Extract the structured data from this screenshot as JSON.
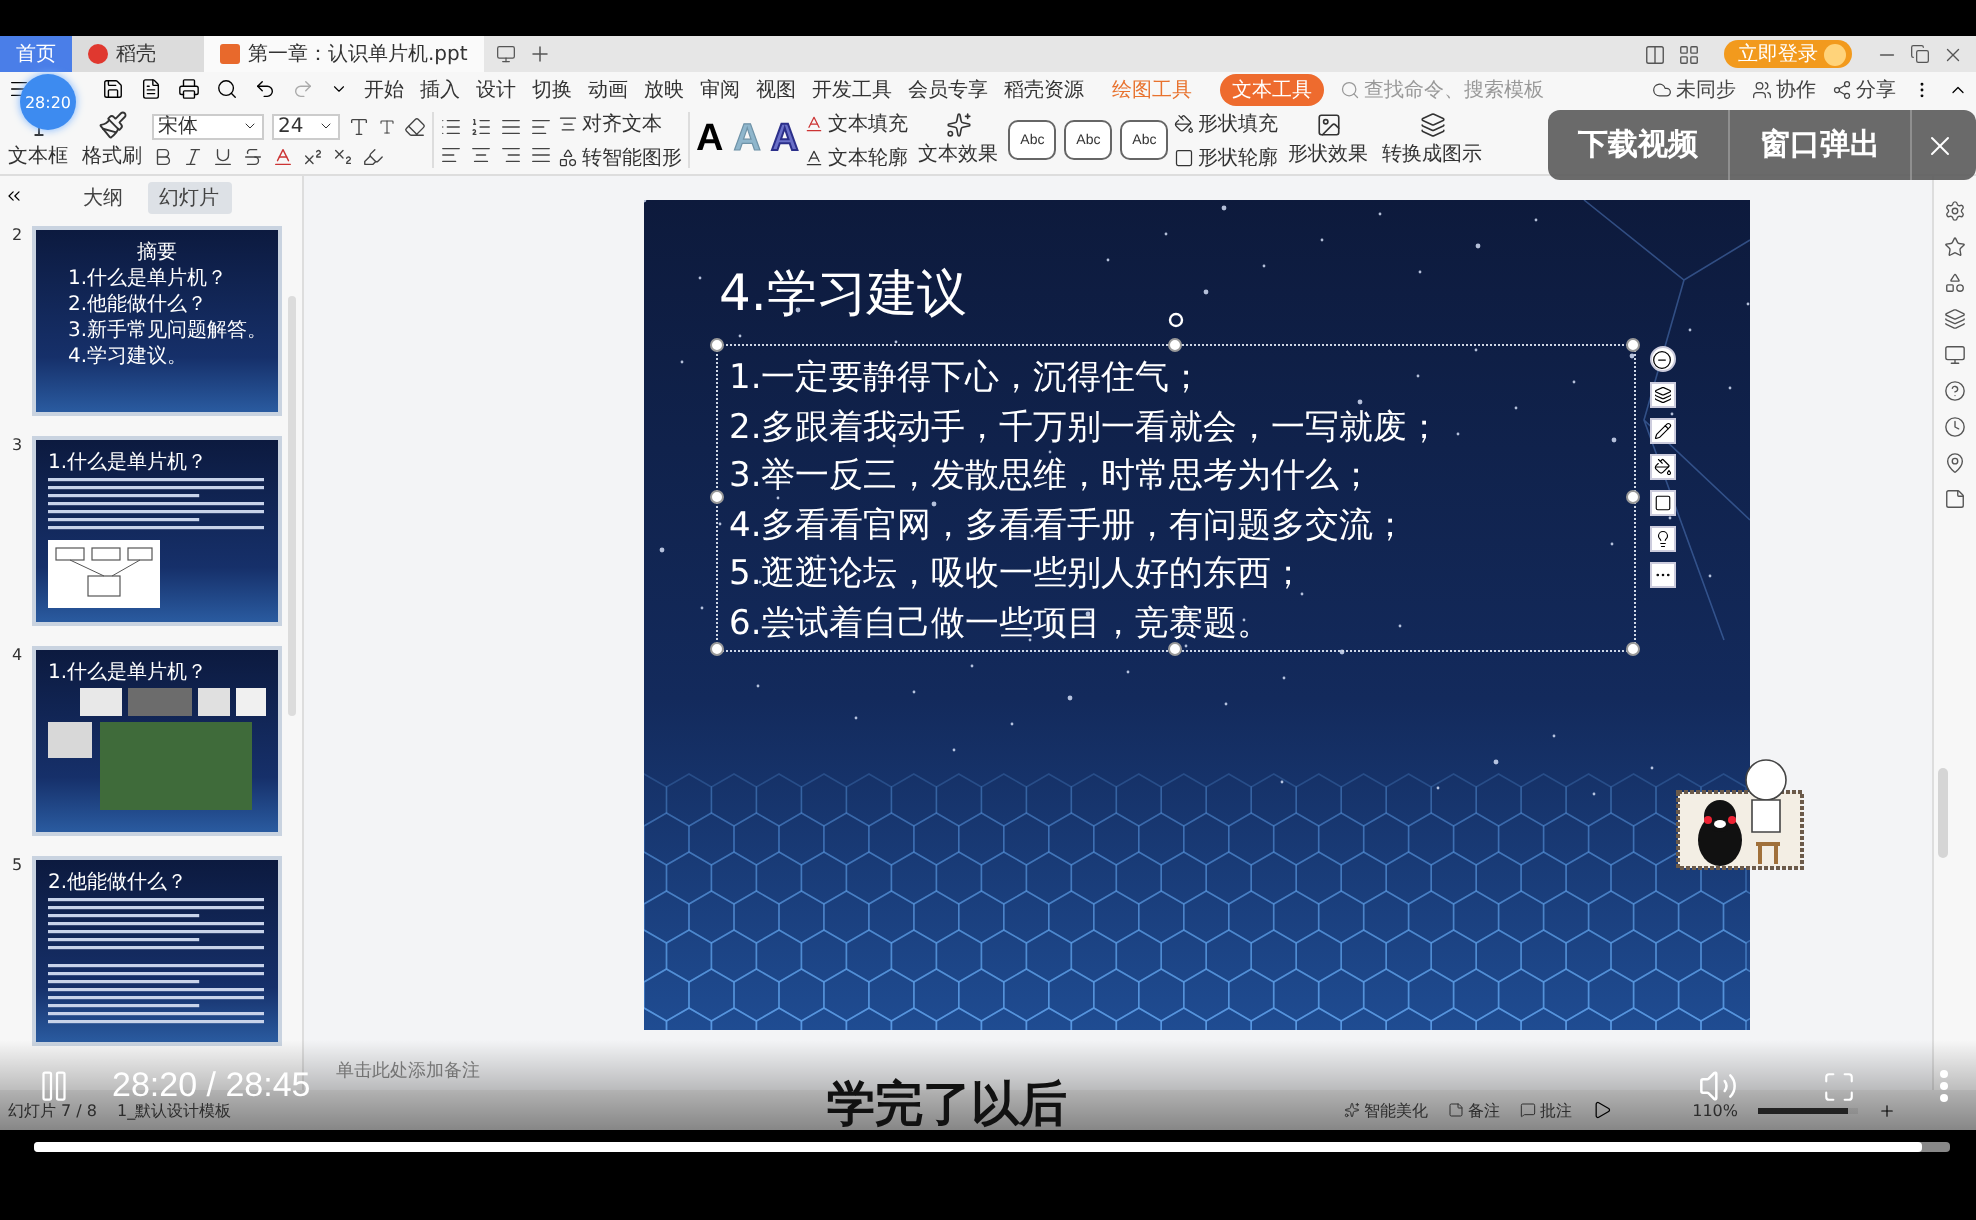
{
  "tab_bar": {
    "tabs": [
      {
        "label": "首页",
        "selected": false,
        "kind": "home"
      },
      {
        "label": "稻壳",
        "selected": false,
        "kind": "app"
      },
      {
        "label": "第一章：认识单片机.ppt",
        "selected": true,
        "kind": "doc"
      }
    ],
    "login": "立即登录"
  },
  "time_bubble": "28:20",
  "menu": {
    "items": [
      {
        "label": "开始",
        "selected": false
      },
      {
        "label": "插入",
        "selected": false
      },
      {
        "label": "设计",
        "selected": false
      },
      {
        "label": "切换",
        "selected": false
      },
      {
        "label": "动画",
        "selected": false
      },
      {
        "label": "放映",
        "selected": false
      },
      {
        "label": "审阅",
        "selected": false
      },
      {
        "label": "视图",
        "selected": false
      },
      {
        "label": "开发工具",
        "selected": false
      },
      {
        "label": "会员专享",
        "selected": false
      },
      {
        "label": "稻壳资源",
        "selected": false
      }
    ],
    "context_tabs": [
      {
        "label": "绘图工具",
        "selected": false
      },
      {
        "label": "文本工具",
        "selected": true
      }
    ],
    "search": {
      "placeholder": "查找命令、搜索模板"
    },
    "actions": [
      "未同步",
      "协作",
      "分享"
    ]
  },
  "ribbon": {
    "text_box": "文本框",
    "format_painter": "格式刷",
    "font": "宋体",
    "font_size": "24",
    "align_text": "对齐文本",
    "smart_art": "转智能图形",
    "text_fill": "文本填充",
    "text_outline": "文本轮廓",
    "text_effect": "文本效果",
    "text_styles": [
      "A",
      "A",
      "A"
    ],
    "style_samples": [
      "Abc",
      "Abc",
      "Abc"
    ],
    "shape_fill": "形状填充",
    "shape_outline": "形状轮廓",
    "shape_effect": "形状效果",
    "convert": "转换成图示"
  },
  "video_popup": {
    "buttons": [
      "下载视频",
      "窗口弹出"
    ]
  },
  "sidebar": {
    "tabs": [
      {
        "label": "大纲",
        "selected": false
      },
      {
        "label": "幻灯片",
        "selected": true
      }
    ],
    "slides": [
      {
        "number": "2",
        "kind": "list",
        "title": "摘要",
        "lines": [
          "1.什么是单片机？",
          "2.他能做什么？",
          "3.新手常见问题解答。",
          "4.学习建议。"
        ]
      },
      {
        "number": "3",
        "kind": "diagram",
        "title": "1.什么是单片机？"
      },
      {
        "number": "4",
        "kind": "photos",
        "title": "1.什么是单片机？"
      },
      {
        "number": "5",
        "kind": "text",
        "title": "2.他能做什么？"
      }
    ]
  },
  "slide": {
    "title": "4.学习建议",
    "lines": [
      "1.一定要静得下心，沉得住气；",
      "2.多跟着我动手，千万别一看就会，一写就废；",
      "3.举一反三，发散思维，时常思考为什么；",
      "4.多看看官网，多看看手册，有问题多交流；",
      "5.逛逛论坛，吸收一些别人好的东西；",
      "6.尝试着自己做一些项目，竞赛题。"
    ]
  },
  "notes": {
    "placeholder": "单击此处添加备注"
  },
  "status_bar": {
    "slide_count": "幻灯片 7 / 8",
    "template": "1_默认设计模板",
    "beautify": "智能美化",
    "notes": "备注",
    "comments": "批注",
    "zoom": "110%",
    "zoom_slider": {
      "level": 0.9
    }
  },
  "player": {
    "playing": true,
    "time": "28:20 / 28:45",
    "subtitle": "学完了以后",
    "progress": {
      "level": 0.985
    }
  }
}
